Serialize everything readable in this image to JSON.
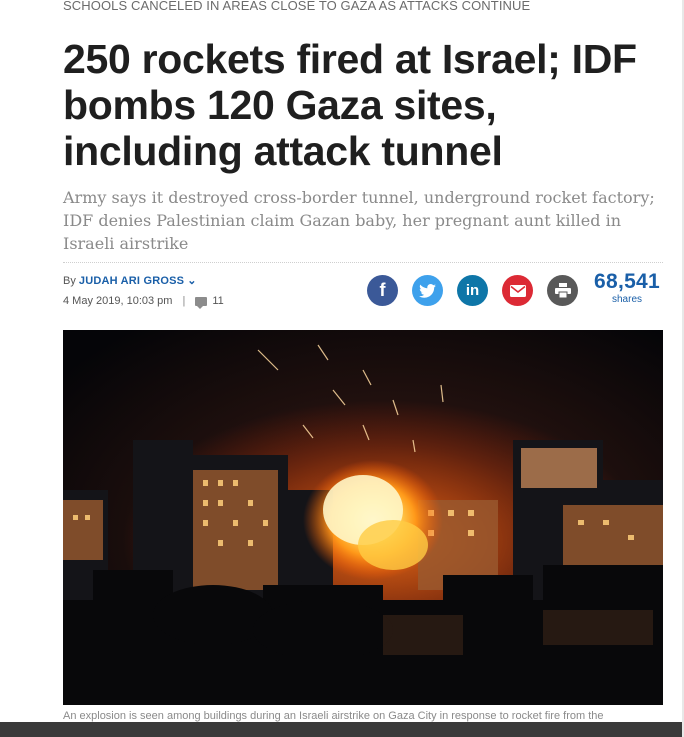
{
  "kicker": "SCHOOLS CANCELED IN AREAS CLOSE TO GAZA AS ATTACKS CONTINUE",
  "headline": "250 rockets fired at Israel; IDF bombs 120 Gaza sites, including attack tunnel",
  "subheadline": "Army says it destroyed cross-border tunnel, underground rocket factory; IDF denies Palestinian claim Gazan baby, her pregnant aunt killed in Israeli airstrike",
  "byline": {
    "prefix": "By",
    "author": "JUDAH ARI GROSS",
    "date": "4 May 2019, 10:03 pm",
    "separator": "|",
    "comments": "11"
  },
  "share": {
    "buttons": [
      {
        "name": "facebook",
        "icon": "facebook-icon",
        "color": "#3b5998"
      },
      {
        "name": "twitter",
        "icon": "twitter-icon",
        "color": "#3ea1ec"
      },
      {
        "name": "linkedin",
        "icon": "linkedin-icon",
        "color": "#0e76a8"
      },
      {
        "name": "email",
        "icon": "email-icon",
        "color": "#dc2a35"
      },
      {
        "name": "print",
        "icon": "print-icon",
        "color": "#595959"
      }
    ],
    "count": "68,541",
    "count_label": "shares"
  },
  "image": {
    "caption": "An explosion is seen among buildings during an Israeli airstrike on Gaza City in response to rocket fire from the"
  }
}
